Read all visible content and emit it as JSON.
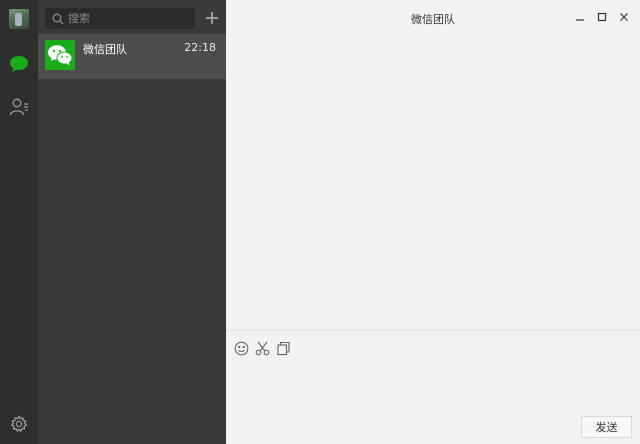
{
  "sidebar": {
    "avatar": "user-avatar",
    "icons": [
      "chat-bubble-icon",
      "contacts-icon",
      "settings-gear-icon"
    ],
    "active_color": "#1aad19"
  },
  "list_panel": {
    "search": {
      "placeholder": "搜索",
      "value": ""
    },
    "add_icon": "plus-icon",
    "conversations": [
      {
        "name": "微信团队",
        "time": "22:18",
        "avatar_icon": "wechat-logo-icon",
        "avatar_color": "#1aad19"
      }
    ]
  },
  "chat": {
    "title": "微信团队",
    "window_controls": [
      "minimize-icon",
      "maximize-icon",
      "close-icon"
    ],
    "toolbar": [
      "emoji-icon",
      "scissors-icon",
      "file-icon"
    ],
    "send_label": "发送"
  }
}
